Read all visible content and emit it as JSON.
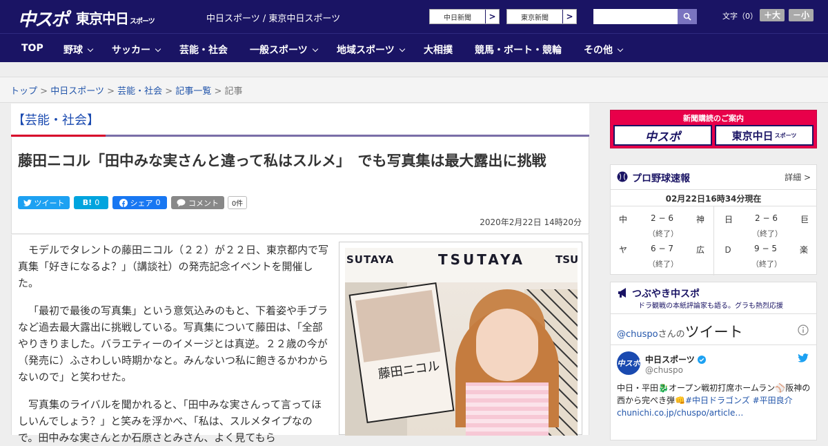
{
  "header": {
    "logo_main": "中スポ",
    "logo_tokyo": "東京中日",
    "logo_tokyo_small": "スポーツ",
    "site_names": "中日スポーツ / 東京中日スポーツ",
    "link_chunichi": "中日新聞",
    "link_tokyo": "東京新聞",
    "link_arrow": ">",
    "search_placeholder": "",
    "font_size_label": "文字（0）",
    "font_larger": "＋大",
    "font_smaller": "－小"
  },
  "nav": {
    "items": [
      "TOP",
      "野球",
      "サッカー",
      "芸能・社会",
      "一般スポーツ",
      "地域スポーツ",
      "大相撲",
      "競馬・ボート・競輪",
      "その他"
    ]
  },
  "breadcrumb": {
    "items": [
      "トップ",
      "中日スポーツ",
      "芸能・社会",
      "記事一覧"
    ],
    "separator": ">",
    "current": "記事"
  },
  "article": {
    "category": "【芸能・社会】",
    "headline": "藤田ニコル「田中みな実さんと違って私はスルメ」　でも写真集は最大露出に挑戦",
    "share": {
      "tweet": "ツイート",
      "hatena_label": "B!",
      "hatena_count": "0",
      "facebook": "シェア",
      "facebook_count": "0",
      "comment": "コメント",
      "comment_count": "0件"
    },
    "date": "2020年2月22日 14時20分",
    "paragraphs": [
      "モデルでタレントの藤田ニコル（２２）が２２日、東京都内で写真集「好きになるよ？」（講談社）の発売記念イベントを開催した。",
      "「最初で最後の写真集」という意気込みのもと、下着姿や手ブラなど過去最大露出に挑戦している。写真集について藤田は、「全部やりきりました。バラエティーのイメージとは真逆。２２歳の今が（発売に）ふさわしい時期かなと。みんないつ私に飽きるかわからないので」と笑わせた。",
      "写真集のライバルを聞かれると、「田中みな実さんって言ってほしいんでしょう？」と笑みを浮かべ、「私は、スルメタイプなので。田中みな実さんとか石原さとみさん、よく見てもら"
    ],
    "photo_signs": [
      "SUTAYA",
      "TSUTAYA",
      "TSU"
    ],
    "photo_book_title": "藤田ニコル"
  },
  "sidebar": {
    "subscribe": {
      "title": "新聞購読のご案内",
      "btn1": "中スポ",
      "btn2": "東京中日",
      "btn2_small": "スポーツ"
    },
    "baseball": {
      "title": "プロ野球速報",
      "detail": "詳細 >",
      "updated": "02月22日16時34分現在",
      "games": [
        {
          "home": "中",
          "score": "2 − 6",
          "away": "神",
          "status": "（終了）"
        },
        {
          "home": "日",
          "score": "2 − 6",
          "away": "巨",
          "status": "（終了）"
        },
        {
          "home": "ヤ",
          "score": "6 − 7",
          "away": "広",
          "status": "（終了）"
        },
        {
          "home": "Ｄ",
          "score": "9 − 5",
          "away": "楽",
          "status": "（終了）"
        }
      ]
    },
    "tweets": {
      "title": "つぶやき中スポ",
      "subtitle": "ドラ観戦の本紙評論家も語る。グラも熱烈応援",
      "handle_link": "@chuspo",
      "handle_suffix": "さんの",
      "tweet_word": "ツイート",
      "account_name": "中日スポーツ",
      "account_handle": "@chuspo",
      "tweet_text": "中日・平田🐉オープン戦初打席ホームラン⚾阪神の西から完ぺき弾👊",
      "hashtags": "#中日ドラゴンズ #平田良介",
      "tweet_link": "chunichi.co.jp/chuspo/article…"
    }
  },
  "colors": {
    "navy": "#1a1464",
    "red": "#d8002a",
    "link": "#2255aa",
    "twitter": "#1da1f2",
    "hatena": "#00a4de",
    "facebook": "#1877f2"
  }
}
